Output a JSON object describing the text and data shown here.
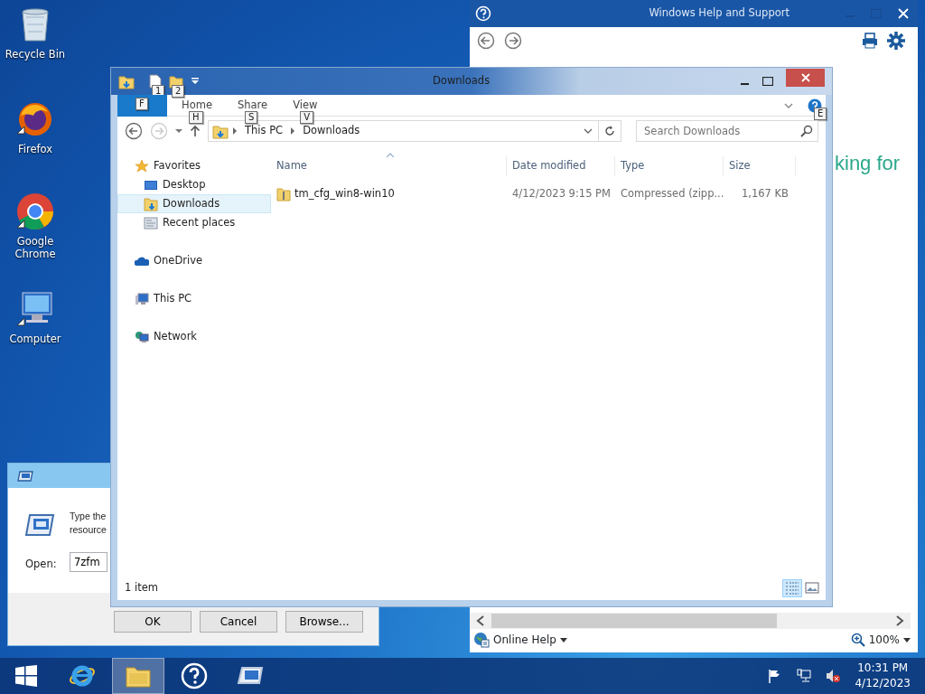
{
  "desktop_icons": [
    {
      "kind": "recycle",
      "label": "Recycle Bin"
    },
    {
      "kind": "firefox",
      "label": "Firefox"
    },
    {
      "kind": "chrome",
      "label": "Google Chrome"
    },
    {
      "kind": "computer",
      "label": "Computer"
    }
  ],
  "help_window": {
    "title": "Windows Help and Support",
    "partial_heading": "king for",
    "online_help": "Online Help",
    "zoom": "100%"
  },
  "run_dialog": {
    "prompt_lines": [
      "Type the",
      "resource"
    ],
    "open_label": "Open:",
    "open_value": "7zfm",
    "buttons": [
      "OK",
      "Cancel",
      "Browse..."
    ]
  },
  "explorer": {
    "title": "Downloads",
    "quick_access_keytips": [
      "1",
      "2"
    ],
    "ribbon_tabs": [
      {
        "kind": "file",
        "keytip": "F"
      },
      {
        "kind": "tab",
        "label": "Home",
        "keytip": "H"
      },
      {
        "kind": "tab",
        "label": "Share",
        "keytip": "S"
      },
      {
        "kind": "tab",
        "label": "View",
        "keytip": "V"
      }
    ],
    "help_keytip": "E",
    "breadcrumb": [
      "This PC",
      "Downloads"
    ],
    "search": {
      "placeholder": "Search Downloads"
    },
    "nav": [
      {
        "kind": "favorites",
        "label": "Favorites",
        "selected": false,
        "children": [
          {
            "kind": "desktop",
            "label": "Desktop",
            "selected": false
          },
          {
            "kind": "downloads",
            "label": "Downloads",
            "selected": true
          },
          {
            "kind": "recent",
            "label": "Recent places",
            "selected": false
          }
        ]
      },
      {
        "kind": "onedrive",
        "label": "OneDrive",
        "selected": false
      },
      {
        "kind": "pc",
        "label": "This PC",
        "selected": false
      },
      {
        "kind": "network",
        "label": "Network",
        "selected": false
      }
    ],
    "columns": [
      "Name",
      "Date modified",
      "Type",
      "Size"
    ],
    "rows": [
      {
        "name": "tm_cfg_win8-win10",
        "date": "4/12/2023 9:15 PM",
        "type": "Compressed (zipp...",
        "size": "1,167 KB"
      }
    ],
    "status": "1 item",
    "views": [
      {
        "kind": "details",
        "selected": true
      },
      {
        "kind": "large",
        "selected": false
      }
    ]
  },
  "taskbar": {
    "apps": [
      {
        "kind": "ie",
        "active": false
      },
      {
        "kind": "explorer",
        "active": true
      },
      {
        "kind": "help",
        "active": false
      },
      {
        "kind": "run",
        "active": false
      }
    ],
    "time": "10:31 PM",
    "date": "4/12/2023"
  }
}
